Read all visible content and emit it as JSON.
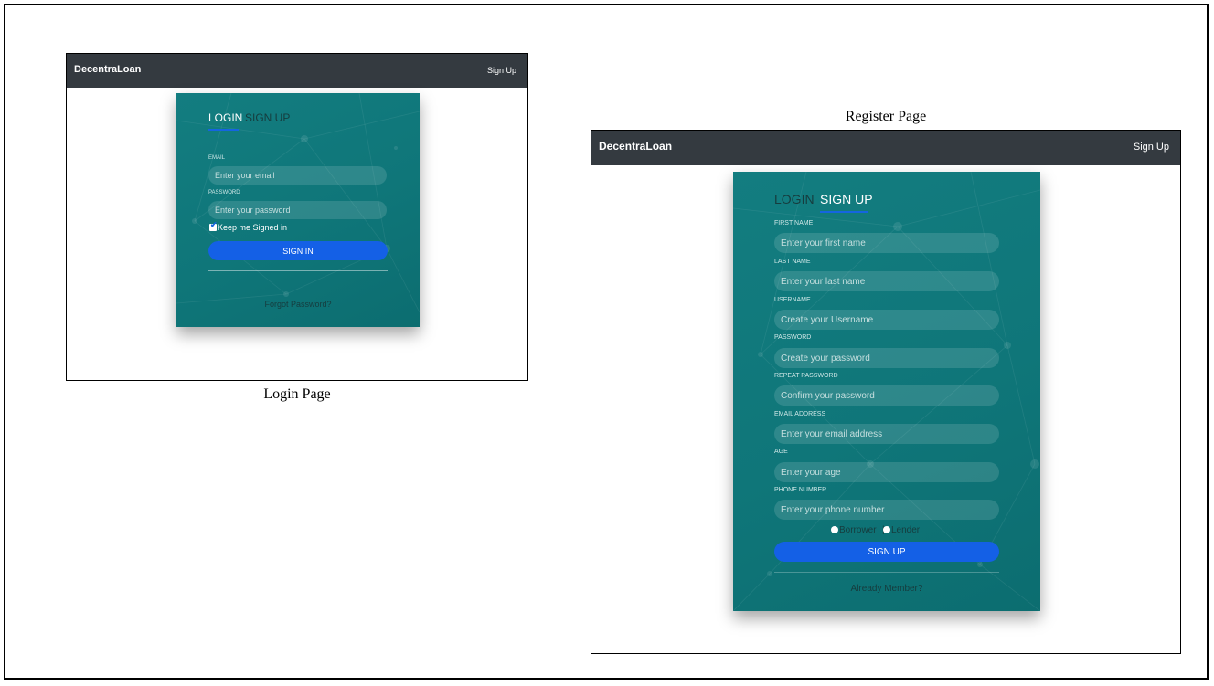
{
  "captions": {
    "login": "Login Page",
    "register": "Register Page"
  },
  "navbar": {
    "brand": "DecentraLoan",
    "signup_link": "Sign Up"
  },
  "login_form": {
    "tab_login": "LOGIN",
    "tab_signup": "SIGN UP",
    "email_label": "EMAIL",
    "email_placeholder": "Enter your email",
    "password_label": "PASSWORD",
    "password_placeholder": "Enter your password",
    "keep_signed_in": "Keep me Signed in",
    "keep_signed_in_checked": true,
    "submit": "SIGN IN",
    "forgot": "Forgot Password?"
  },
  "register_form": {
    "tab_login": "LOGIN",
    "tab_signup": "SIGN UP",
    "fields": [
      {
        "label": "FIRST NAME",
        "placeholder": "Enter your first name"
      },
      {
        "label": "LAST NAME",
        "placeholder": "Enter your last name"
      },
      {
        "label": "USERNAME",
        "placeholder": "Create your Username"
      },
      {
        "label": "PASSWORD",
        "placeholder": "Create your password"
      },
      {
        "label": "REPEAT PASSWORD",
        "placeholder": "Confirm your password"
      },
      {
        "label": "EMAIL ADDRESS",
        "placeholder": "Enter your email address"
      },
      {
        "label": "AGE",
        "placeholder": "Enter your age"
      },
      {
        "label": "PHONE NUMBER",
        "placeholder": "Enter your phone number"
      }
    ],
    "role_borrower": "Borrower",
    "role_separator": "|",
    "role_lender": "Lender",
    "submit": "SIGN UP",
    "already_member": "Already Member?"
  },
  "colors": {
    "navbar": "#343a40",
    "card": "#0f7679",
    "button": "#1460e6",
    "tab_underline": "#1565e0"
  }
}
